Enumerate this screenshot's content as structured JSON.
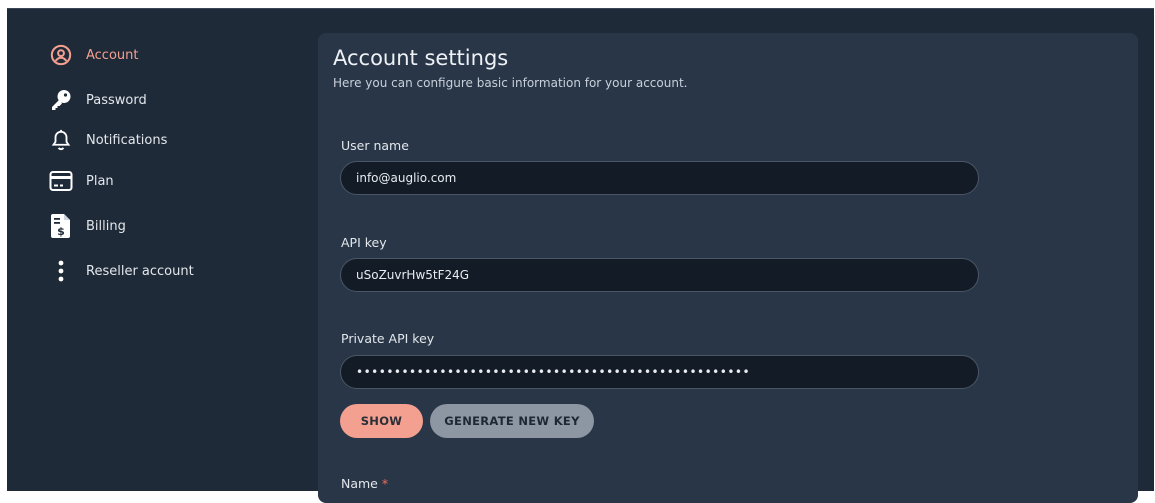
{
  "sidebar": {
    "items": [
      {
        "label": "Account",
        "icon": "user-circle-icon",
        "active": true
      },
      {
        "label": "Password",
        "icon": "key-icon"
      },
      {
        "label": "Notifications",
        "icon": "bell-icon"
      },
      {
        "label": "Plan",
        "icon": "credit-card-icon"
      },
      {
        "label": "Billing",
        "icon": "invoice-icon"
      },
      {
        "label": "Reseller account",
        "icon": "more-vertical-icon"
      }
    ]
  },
  "main": {
    "title": "Account settings",
    "subtitle": "Here you can configure basic information for your account.",
    "fields": {
      "username": {
        "label": "User name",
        "value": "info@auglio.com"
      },
      "api_key": {
        "label": "API key",
        "value": "uSoZuvrHw5tF24G"
      },
      "private_key": {
        "label": "Private API key",
        "value": "••••••••••••••••••••••••••••••••••••••••••••••••••••"
      },
      "name": {
        "label": "Name",
        "required_marker": "*"
      }
    },
    "buttons": {
      "show": "SHOW",
      "generate": "GENERATE NEW KEY"
    }
  },
  "colors": {
    "accent": "#f4a090",
    "background": "#1f2a38",
    "panel": "#283647",
    "input": "#131c26",
    "required": "#f06a5a"
  }
}
